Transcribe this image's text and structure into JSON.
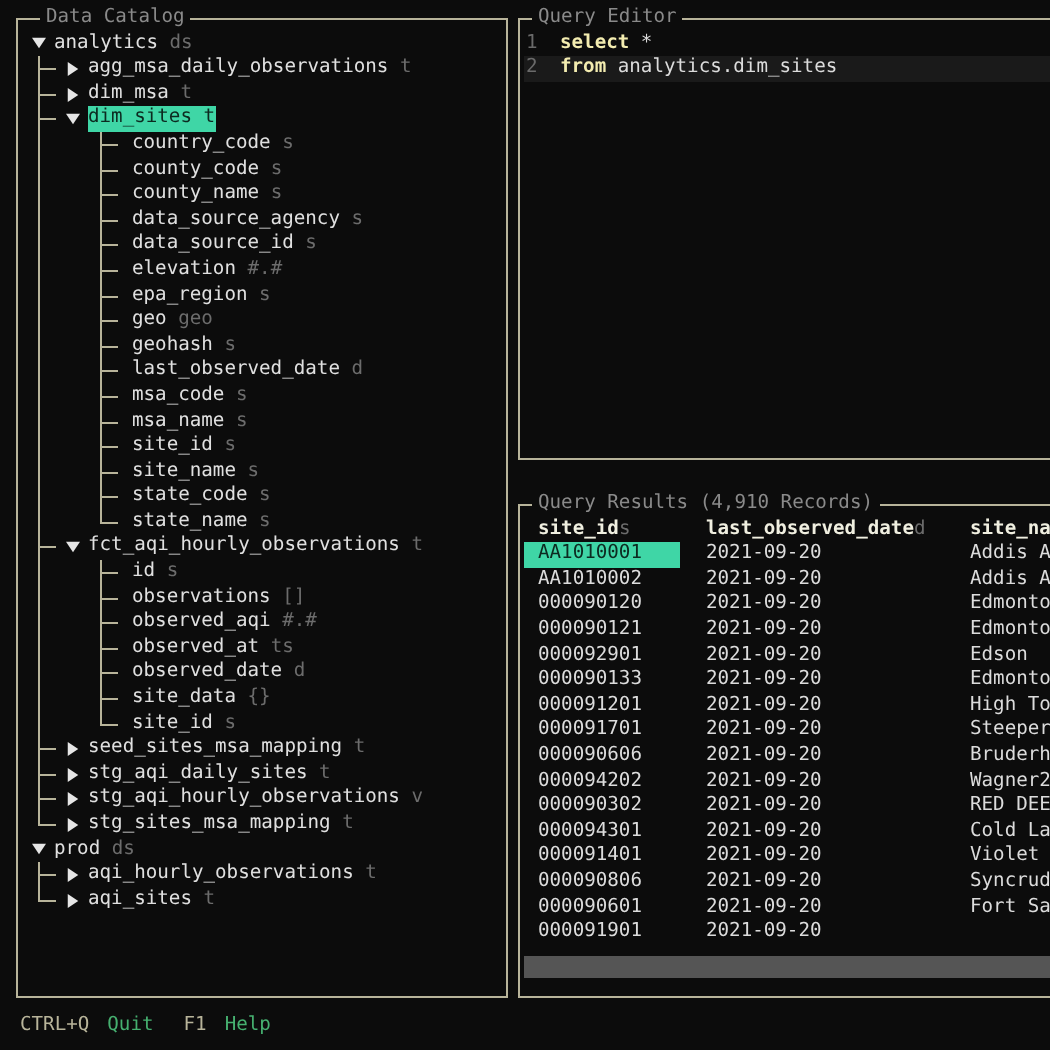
{
  "catalog": {
    "title": "Data Catalog",
    "tree": [
      {
        "name": "analytics",
        "type": "ds",
        "expanded": true,
        "selected": false,
        "children": [
          {
            "name": "agg_msa_daily_observations",
            "type": "t",
            "expanded": false,
            "selected": false
          },
          {
            "name": "dim_msa",
            "type": "t",
            "expanded": false,
            "selected": false
          },
          {
            "name": "dim_sites",
            "type": "t",
            "expanded": true,
            "selected": true,
            "children": [
              {
                "name": "country_code",
                "type": "s",
                "selected": false
              },
              {
                "name": "county_code",
                "type": "s",
                "selected": false
              },
              {
                "name": "county_name",
                "type": "s",
                "selected": false
              },
              {
                "name": "data_source_agency",
                "type": "s",
                "selected": false
              },
              {
                "name": "data_source_id",
                "type": "s",
                "selected": false
              },
              {
                "name": "elevation",
                "type": "#.#",
                "selected": false
              },
              {
                "name": "epa_region",
                "type": "s",
                "selected": false
              },
              {
                "name": "geo",
                "type": "geo",
                "selected": false
              },
              {
                "name": "geohash",
                "type": "s",
                "selected": false
              },
              {
                "name": "last_observed_date",
                "type": "d",
                "selected": false
              },
              {
                "name": "msa_code",
                "type": "s",
                "selected": false
              },
              {
                "name": "msa_name",
                "type": "s",
                "selected": false
              },
              {
                "name": "site_id",
                "type": "s",
                "selected": false
              },
              {
                "name": "site_name",
                "type": "s",
                "selected": false
              },
              {
                "name": "state_code",
                "type": "s",
                "selected": false
              },
              {
                "name": "state_name",
                "type": "s",
                "selected": false
              }
            ]
          },
          {
            "name": "fct_aqi_hourly_observations",
            "type": "t",
            "expanded": true,
            "selected": false,
            "children": [
              {
                "name": "id",
                "type": "s",
                "selected": false
              },
              {
                "name": "observations",
                "type": "[]",
                "selected": false
              },
              {
                "name": "observed_aqi",
                "type": "#.#",
                "selected": false
              },
              {
                "name": "observed_at",
                "type": "ts",
                "selected": false
              },
              {
                "name": "observed_date",
                "type": "d",
                "selected": false
              },
              {
                "name": "site_data",
                "type": "{}",
                "selected": false
              },
              {
                "name": "site_id",
                "type": "s",
                "selected": false
              }
            ]
          },
          {
            "name": "seed_sites_msa_mapping",
            "type": "t",
            "expanded": false,
            "selected": false
          },
          {
            "name": "stg_aqi_daily_sites",
            "type": "t",
            "expanded": false,
            "selected": false
          },
          {
            "name": "stg_aqi_hourly_observations",
            "type": "v",
            "expanded": false,
            "selected": false
          },
          {
            "name": "stg_sites_msa_mapping",
            "type": "t",
            "expanded": false,
            "selected": false
          }
        ]
      },
      {
        "name": "prod",
        "type": "ds",
        "expanded": true,
        "selected": false,
        "children": [
          {
            "name": "aqi_hourly_observations",
            "type": "t",
            "expanded": false,
            "selected": false
          },
          {
            "name": "aqi_sites",
            "type": "t",
            "expanded": false,
            "selected": false
          }
        ]
      }
    ]
  },
  "editor": {
    "title": "Query Editor",
    "lines": [
      {
        "number": "1",
        "current": false,
        "tokens": [
          {
            "text": "select",
            "kind": "keyword"
          },
          {
            "text": " *",
            "kind": "plain"
          }
        ]
      },
      {
        "number": "2",
        "current": true,
        "tokens": [
          {
            "text": "from",
            "kind": "keyword"
          },
          {
            "text": " analytics.dim_sites",
            "kind": "plain"
          }
        ]
      }
    ]
  },
  "results": {
    "title": "Query Results (4,910 Records)",
    "columns": [
      {
        "name": "site_id",
        "type": "s"
      },
      {
        "name": "last_observed_date",
        "type": "d"
      },
      {
        "name": "site_na"
      }
    ],
    "rows": [
      [
        {
          "text": "AA1010001",
          "selected": true
        },
        {
          "text": "2021-09-20",
          "selected": false
        },
        {
          "text": "Addis A",
          "selected": false
        }
      ],
      [
        {
          "text": "AA1010002",
          "selected": false
        },
        {
          "text": "2021-09-20",
          "selected": false
        },
        {
          "text": "Addis A",
          "selected": false
        }
      ],
      [
        {
          "text": "000090120",
          "selected": false
        },
        {
          "text": "2021-09-20",
          "selected": false
        },
        {
          "text": "Edmonto",
          "selected": false
        }
      ],
      [
        {
          "text": "000090121",
          "selected": false
        },
        {
          "text": "2021-09-20",
          "selected": false
        },
        {
          "text": "Edmonto",
          "selected": false
        }
      ],
      [
        {
          "text": "000092901",
          "selected": false
        },
        {
          "text": "2021-09-20",
          "selected": false
        },
        {
          "text": "Edson",
          "selected": false
        }
      ],
      [
        {
          "text": "000090133",
          "selected": false
        },
        {
          "text": "2021-09-20",
          "selected": false
        },
        {
          "text": "Edmonto",
          "selected": false
        }
      ],
      [
        {
          "text": "000091201",
          "selected": false
        },
        {
          "text": "2021-09-20",
          "selected": false
        },
        {
          "text": "High To",
          "selected": false
        }
      ],
      [
        {
          "text": "000091701",
          "selected": false
        },
        {
          "text": "2021-09-20",
          "selected": false
        },
        {
          "text": "Steeper",
          "selected": false
        }
      ],
      [
        {
          "text": "000090606",
          "selected": false
        },
        {
          "text": "2021-09-20",
          "selected": false
        },
        {
          "text": "Bruderh",
          "selected": false
        }
      ],
      [
        {
          "text": "000094202",
          "selected": false
        },
        {
          "text": "2021-09-20",
          "selected": false
        },
        {
          "text": "Wagner2",
          "selected": false
        }
      ],
      [
        {
          "text": "000090302",
          "selected": false
        },
        {
          "text": "2021-09-20",
          "selected": false
        },
        {
          "text": "RED DEE",
          "selected": false
        }
      ],
      [
        {
          "text": "000094301",
          "selected": false
        },
        {
          "text": "2021-09-20",
          "selected": false
        },
        {
          "text": "Cold La",
          "selected": false
        }
      ],
      [
        {
          "text": "000091401",
          "selected": false
        },
        {
          "text": "2021-09-20",
          "selected": false
        },
        {
          "text": "Violet",
          "selected": false
        }
      ],
      [
        {
          "text": "000090806",
          "selected": false
        },
        {
          "text": "2021-09-20",
          "selected": false
        },
        {
          "text": "Syncrud",
          "selected": false
        }
      ],
      [
        {
          "text": "000090601",
          "selected": false
        },
        {
          "text": "2021-09-20",
          "selected": false
        },
        {
          "text": "Fort Sa",
          "selected": false
        }
      ],
      [
        {
          "text": "000091901",
          "selected": false
        },
        {
          "text": "2021-09-20",
          "selected": false
        }
      ]
    ]
  },
  "footer": [
    {
      "key": "CTRL+Q",
      "action": "Quit"
    },
    {
      "key": "F1",
      "action": "Help"
    }
  ]
}
